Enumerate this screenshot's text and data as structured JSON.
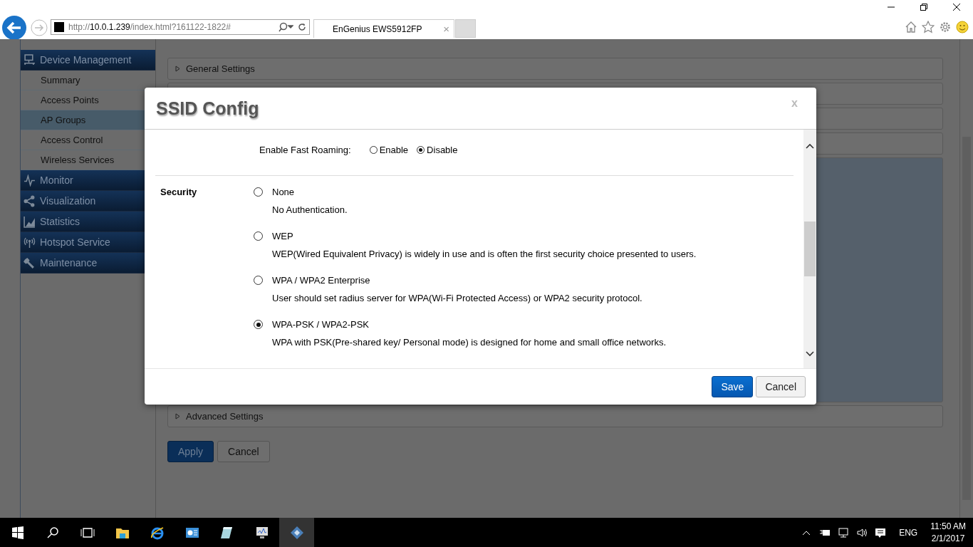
{
  "browser": {
    "url_host": "10.0.1.239",
    "url_scheme": "http://",
    "url_path": "/index.html?161122-1822#",
    "tab_title": "EnGenius EWS5912FP",
    "tab_close": "×"
  },
  "sidebar": {
    "items": [
      {
        "label": "Device Management",
        "children": [
          {
            "label": "Summary",
            "selected": false
          },
          {
            "label": "Access Points",
            "selected": false
          },
          {
            "label": "AP Groups",
            "selected": true
          },
          {
            "label": "Access Control",
            "selected": false
          },
          {
            "label": "Wireless Services",
            "selected": false
          }
        ]
      },
      {
        "label": "Monitor"
      },
      {
        "label": "Visualization"
      },
      {
        "label": "Statistics"
      },
      {
        "label": "Hotspot Service"
      },
      {
        "label": "Maintenance"
      }
    ]
  },
  "page": {
    "panels": [
      {
        "label": "General Settings"
      },
      {
        "label": "Advanced Settings"
      }
    ],
    "buttons": [
      {
        "label": "Apply",
        "kind": "primary"
      },
      {
        "label": "Cancel",
        "kind": "secondary"
      }
    ]
  },
  "modal": {
    "title": "SSID Config",
    "close": "x",
    "fast_roaming": {
      "label": "Enable Fast Roaming:",
      "options": [
        {
          "label": "Enable",
          "selected": false
        },
        {
          "label": "Disable",
          "selected": true
        }
      ]
    },
    "security": {
      "label": "Security",
      "options": [
        {
          "title": "None",
          "description": "No Authentication.",
          "selected": false
        },
        {
          "title": "WEP",
          "description": "WEP(Wired Equivalent Privacy) is widely in use and is often the first security choice presented to users.",
          "selected": false
        },
        {
          "title": "WPA / WPA2 Enterprise",
          "description": "User should set radius server for WPA(Wi-Fi Protected Access) or WPA2 security protocol.",
          "selected": false
        },
        {
          "title": "WPA-PSK / WPA2-PSK",
          "description": "WPA with PSK(Pre-shared key/ Personal mode) is designed for home and small office networks.",
          "selected": true
        }
      ]
    },
    "buttons": [
      {
        "label": "Save",
        "kind": "primary"
      },
      {
        "label": "Cancel",
        "kind": "secondary"
      }
    ]
  },
  "taskbar": {
    "language": "ENG",
    "time": "11:50 AM",
    "date": "2/1/2017"
  }
}
